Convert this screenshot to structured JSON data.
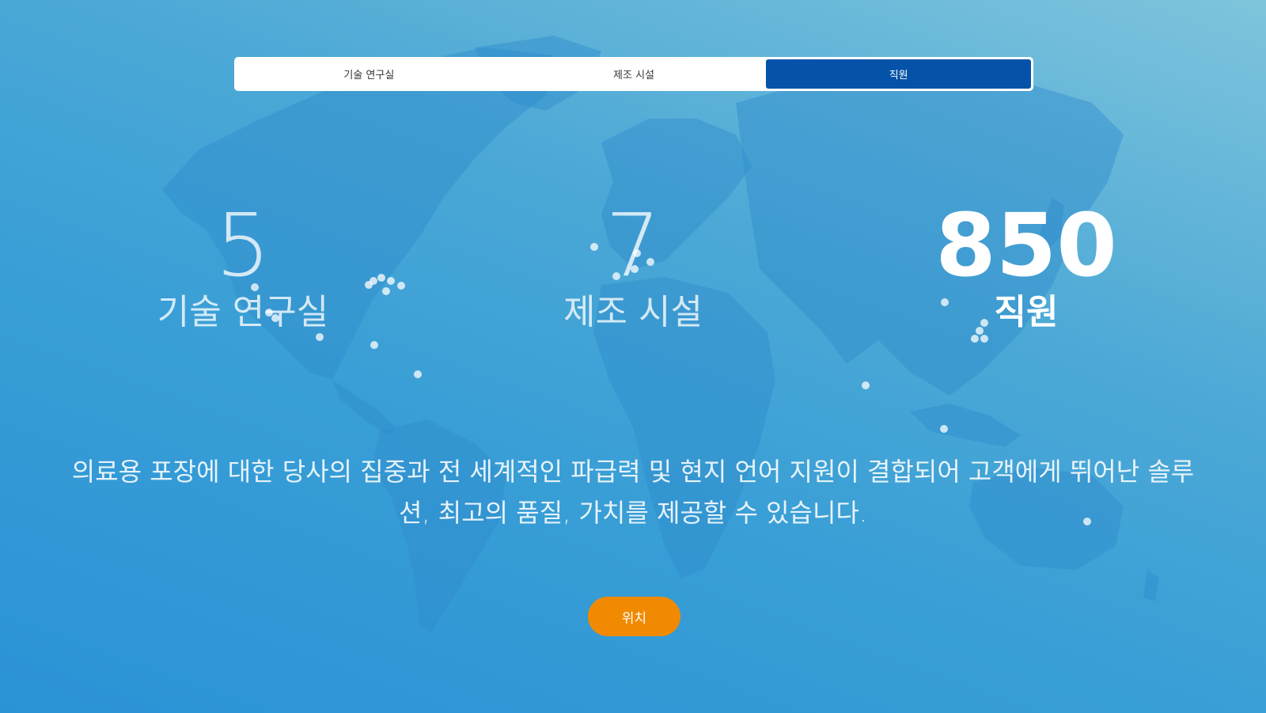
{
  "tabs": [
    {
      "label": "기술 연구실",
      "active": false
    },
    {
      "label": "제조 시설",
      "active": false
    },
    {
      "label": "직원",
      "active": true
    }
  ],
  "stats": [
    {
      "value": "5",
      "label": "기술 연구실"
    },
    {
      "value": "7",
      "label": "제조 시설"
    },
    {
      "value": "850",
      "label": "직원"
    }
  ],
  "description": "의료용 포장에 대한 당사의 집중과 전 세계적인 파급력 및 현지 언어 지원이 결합되어 고객에게 뛰어난 솔루션, 최고의 품질, 가치를 제공할 수 있습니다.",
  "location_button": "위치",
  "colors": {
    "active_tab": "#0453a8",
    "button": "#f18a00",
    "background": "#3a9fd6"
  }
}
